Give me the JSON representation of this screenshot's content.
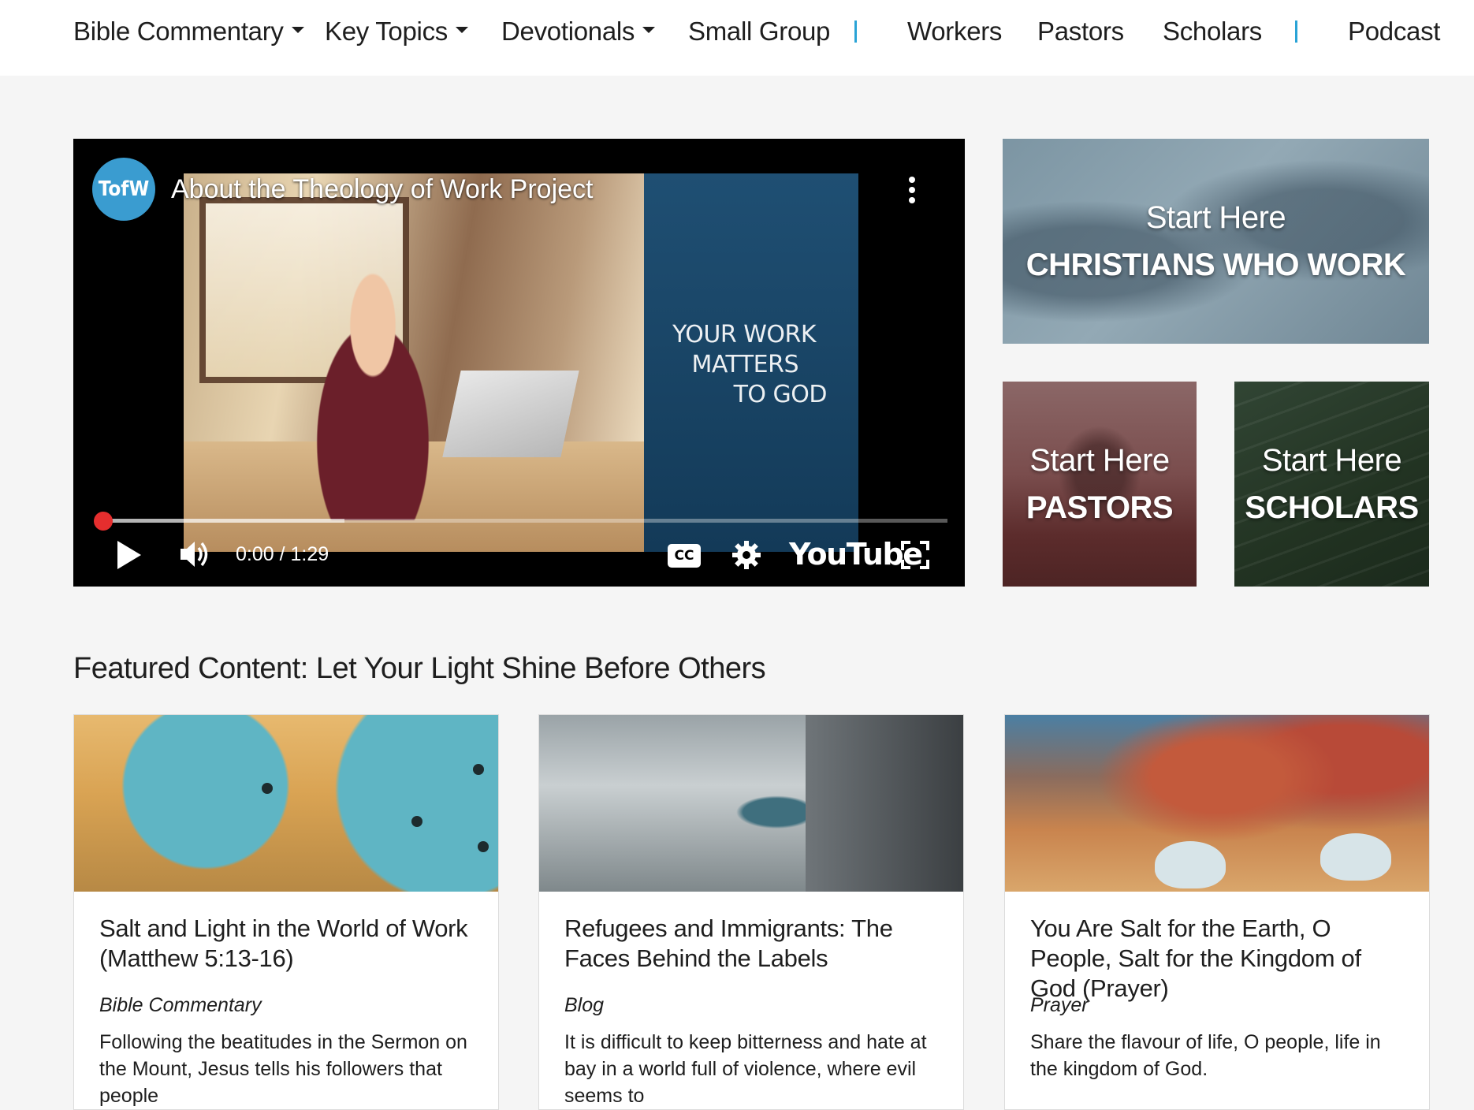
{
  "nav": {
    "items": [
      {
        "label": "Bible Commentary",
        "dropdown": true
      },
      {
        "label": "Key Topics",
        "dropdown": true
      },
      {
        "label": "Devotionals",
        "dropdown": true
      },
      {
        "label": "Small Group",
        "dropdown": false
      },
      {
        "label": "Workers",
        "dropdown": false
      },
      {
        "label": "Pastors",
        "dropdown": false
      },
      {
        "label": "Scholars",
        "dropdown": false
      },
      {
        "label": "Podcast",
        "dropdown": false
      }
    ],
    "separator_color": "#2aa3d6"
  },
  "video": {
    "channel_logo_text": "TofW",
    "title": "About the Theology of Work Project",
    "panel_text": [
      "YOUR WORK",
      "MATTERS",
      "TO GOD"
    ],
    "time": "0:00 / 1:29",
    "progress_fraction": 0.0,
    "cc_label": "CC",
    "platform_label": "YouTube",
    "icons": [
      "menu-kebab-icon",
      "play-icon",
      "volume-icon",
      "captions-icon",
      "settings-gear-icon",
      "fullscreen-icon"
    ]
  },
  "tiles": {
    "christians": {
      "line1": "Start Here",
      "line2": "CHRISTIANS WHO WORK"
    },
    "pastors": {
      "line1": "Start Here",
      "line2": "PASTORS"
    },
    "scholars": {
      "line1": "Start Here",
      "line2": "SCHOLARS"
    }
  },
  "featured": {
    "heading": "Featured Content: Let Your Light Shine Before Others",
    "cards": [
      {
        "title": "Salt and Light in the World of Work (Matthew 5:13-16)",
        "category": "Bible Commentary",
        "description": "Following the beatitudes in the Sermon on the Mount, Jesus tells his followers that people"
      },
      {
        "title": "Refugees and Immigrants: The Faces Behind the Labels",
        "category": "Blog",
        "description": "It is difficult to keep bitterness and hate at bay in a world full of violence, where evil seems to"
      },
      {
        "title": "You Are Salt for the Earth, O People, Salt for the Kingdom of God (Prayer)",
        "category": "Prayer",
        "description": "Share the flavour of life, O people, life in the kingdom of God."
      }
    ]
  },
  "colors": {
    "accent_blue": "#2aa3d6",
    "progress_red": "#e52e2e",
    "page_bg": "#f5f5f5"
  }
}
